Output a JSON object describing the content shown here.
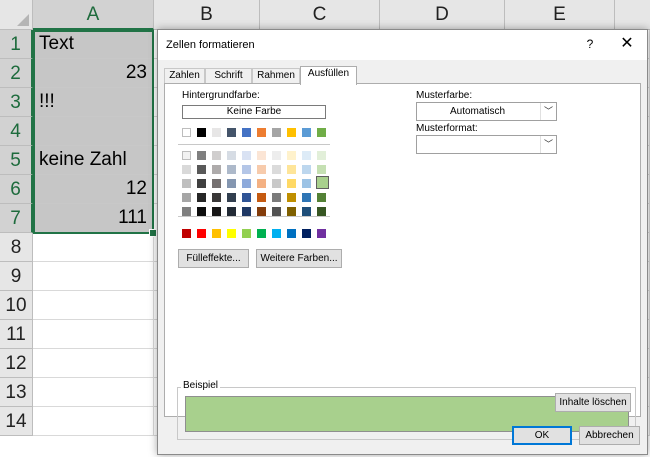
{
  "spreadsheet": {
    "columns": [
      "A",
      "B",
      "C",
      "D",
      "E"
    ],
    "rows": [
      "1",
      "2",
      "3",
      "4",
      "5",
      "6",
      "7",
      "8",
      "9",
      "10",
      "11",
      "12",
      "13",
      "14"
    ],
    "cells_a": [
      {
        "value": "Text",
        "align": "left"
      },
      {
        "value": "23",
        "align": "right"
      },
      {
        "value": "!!!",
        "align": "left"
      },
      {
        "value": "",
        "align": "left"
      },
      {
        "value": "keine Zahl",
        "align": "left"
      },
      {
        "value": "12",
        "align": "right"
      },
      {
        "value": "111",
        "align": "right"
      }
    ]
  },
  "dialog": {
    "title": "Zellen formatieren",
    "help": "?",
    "close": "✕",
    "tabs": [
      {
        "label": "Zahlen",
        "active": false
      },
      {
        "label": "Schrift",
        "active": false
      },
      {
        "label": "Rahmen",
        "active": false
      },
      {
        "label": "Ausfüllen",
        "active": true
      }
    ],
    "fill": {
      "background_label": "Hintergrundfarbe:",
      "no_color_button": "Keine Farbe",
      "palette_top": [
        "#ffffff",
        "#000000",
        "#e7e6e6",
        "#44546a",
        "#4472c4",
        "#ed7d31",
        "#a5a5a5",
        "#ffc000",
        "#5b9bd5",
        "#70ad47"
      ],
      "palette_tints": [
        [
          "#f2f2f2",
          "#7f7f7f",
          "#d0cece",
          "#d6dce4",
          "#d9e2f3",
          "#fbe5d5",
          "#ededed",
          "#fff2cc",
          "#ddebf7",
          "#e2efd9"
        ],
        [
          "#d9d9d9",
          "#595959",
          "#aeabab",
          "#adb9ca",
          "#b4c6e7",
          "#f7cbac",
          "#dbdbdb",
          "#fee599",
          "#bdd7ee",
          "#c5e0b3"
        ],
        [
          "#bfbfbf",
          "#3f3f3f",
          "#757070",
          "#8496b0",
          "#8eaadb",
          "#f4b183",
          "#c9c9c9",
          "#ffd965",
          "#9cc3e5",
          "#a8d08d"
        ],
        [
          "#a6a6a6",
          "#262626",
          "#3a3838",
          "#323f4f",
          "#2f5496",
          "#c55a11",
          "#7b7b7b",
          "#bf8f00",
          "#2e75b5",
          "#538135"
        ],
        [
          "#7f7f7f",
          "#0d0d0d",
          "#171616",
          "#222a35",
          "#1f3864",
          "#833c0b",
          "#525252",
          "#7f6000",
          "#1e4e79",
          "#375623"
        ]
      ],
      "palette_standard": [
        "#c00000",
        "#ff0000",
        "#ffc000",
        "#ffff00",
        "#92d050",
        "#00b050",
        "#00b0f0",
        "#0070c0",
        "#002060",
        "#7030a0"
      ],
      "selected_color": "#a8d08d",
      "fill_effects_button": "Fülleffekte...",
      "more_colors_button": "Weitere Farben...",
      "pattern_color_label": "Musterfarbe:",
      "pattern_color_value": "Automatisch",
      "pattern_style_label": "Musterformat:",
      "pattern_style_value": "",
      "sample_label": "Beispiel",
      "sample_color": "#a8d08d"
    },
    "clear_button": "Inhalte löschen",
    "ok_button": "OK",
    "cancel_button": "Abbrechen"
  }
}
